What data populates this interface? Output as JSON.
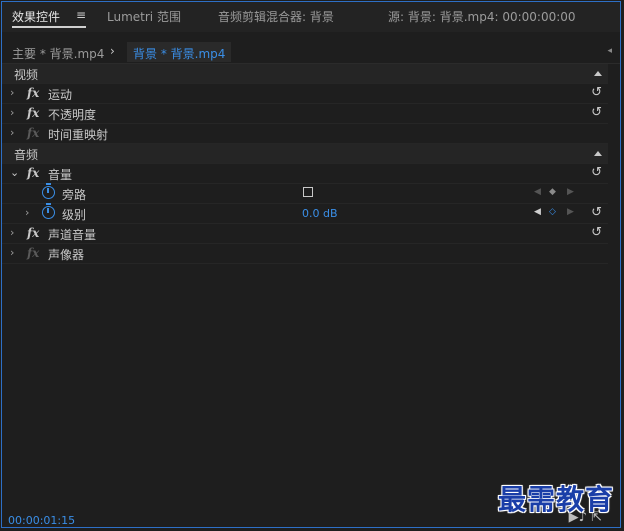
{
  "tabs": [
    {
      "label": "效果控件",
      "menu_glyph": "≡"
    },
    {
      "label": "Lumetri 范围"
    },
    {
      "label": "音频剪辑混合器: 背景"
    },
    {
      "label": "源: 背景: 背景.mp4: 00:00:00:00"
    }
  ],
  "subbar": {
    "master_label": "主要 * 背景.mp4",
    "chevron": "›",
    "clip_label": "背景 * 背景.mp4",
    "expand_glyph": "◂"
  },
  "sections": {
    "video": {
      "label": "视频",
      "effects": [
        {
          "label": "运动",
          "fx": "fx"
        },
        {
          "label": "不透明度",
          "fx": "fx"
        },
        {
          "label": "时间重映射",
          "fx": "fx"
        }
      ]
    },
    "audio": {
      "label": "音频",
      "volume_effect": {
        "label": "音量",
        "fx": "fx"
      },
      "bypass": {
        "label": "旁路",
        "checked": false
      },
      "level": {
        "label": "级别",
        "value": "0.0 dB"
      },
      "channel_volume": {
        "label": "声道音量",
        "fx": "fx"
      },
      "panner": {
        "label": "声像器",
        "fx": "fx"
      }
    }
  },
  "glyphs": {
    "twisty_closed": "›",
    "twisty_open": "⌄",
    "reset": "↺",
    "kf_prev": "◀",
    "kf_add": "◆",
    "kf_next": "▶",
    "kf_add_off": "◇"
  },
  "footer": {
    "timecode": "00:00:01:15",
    "play_audio_icon": "▶♪",
    "export_icon": "⇱"
  },
  "watermark": "最需教育",
  "colors": {
    "accent": "#3a8ee6",
    "frame_border": "#2d6fc6",
    "background": "#1e1e1e"
  }
}
